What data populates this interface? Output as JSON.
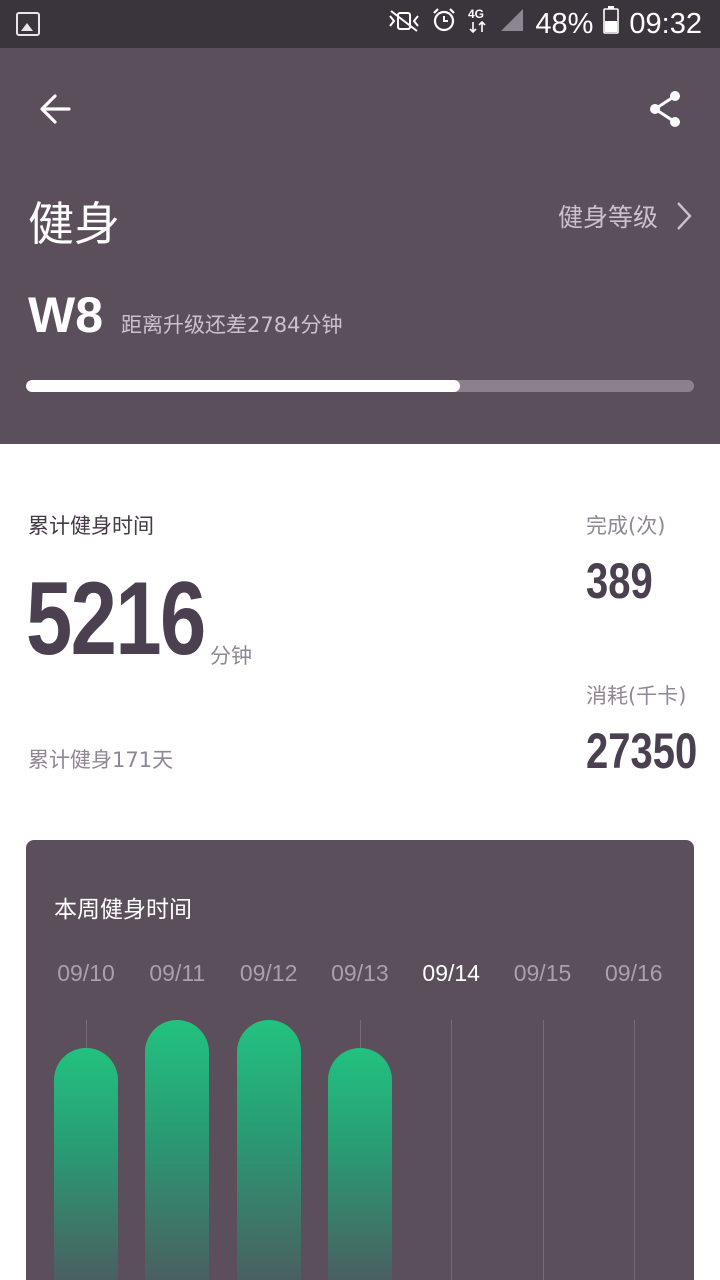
{
  "status_bar": {
    "battery": "48%",
    "time": "09:32",
    "network": "4G",
    "icons": [
      "image-icon",
      "vibrate-icon",
      "alarm-icon",
      "network-4g-icon",
      "signal-icon",
      "battery-icon"
    ]
  },
  "header": {
    "back_icon": "back-arrow-icon",
    "share_icon": "share-icon",
    "title": "健身",
    "level_link": "健身等级",
    "level_code": "W8",
    "level_note": "距离升级还差2784分钟",
    "progress_fraction": 0.65
  },
  "stats": {
    "total_label": "累计健身时间",
    "total_value": "5216",
    "total_unit": "分钟",
    "days_text": "累计健身171天",
    "done_label": "完成(次)",
    "done_value": "389",
    "kcal_label": "消耗(千卡)",
    "kcal_value": "27350"
  },
  "week": {
    "title": "本周健身时间",
    "today": "09/14",
    "chart_data": {
      "type": "bar",
      "categories": [
        "09/10",
        "09/11",
        "09/12",
        "09/13",
        "09/14",
        "09/15",
        "09/16"
      ],
      "values": [
        232,
        260,
        260,
        232,
        0,
        0,
        0
      ]
    }
  },
  "colors": {
    "header_bg": "#5b4f5c",
    "status_bg": "#3a343d",
    "accent_green": "#22c27f",
    "text_dark": "#4a4050"
  }
}
